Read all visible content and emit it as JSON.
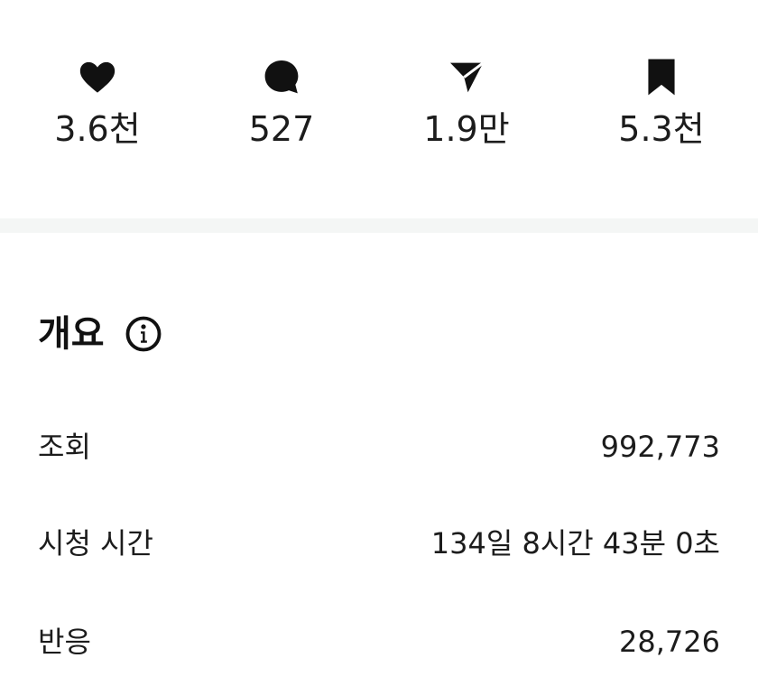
{
  "stats": {
    "likes": {
      "icon": "heart-icon",
      "count": "3.6천"
    },
    "comments": {
      "icon": "comment-icon",
      "count": "527"
    },
    "shares": {
      "icon": "send-icon",
      "count": "1.9만"
    },
    "saves": {
      "icon": "bookmark-icon",
      "count": "5.3천"
    }
  },
  "overview": {
    "title": "개요",
    "info_icon": "info-icon",
    "metrics": [
      {
        "label": "조회",
        "value": "992,773"
      },
      {
        "label": "시청 시간",
        "value": "134일 8시간 43분 0초"
      },
      {
        "label": "반응",
        "value": "28,726"
      }
    ]
  },
  "colors": {
    "text": "#1c1c1c",
    "icon": "#111111",
    "divider": "#f4f6f5",
    "background": "#ffffff"
  }
}
